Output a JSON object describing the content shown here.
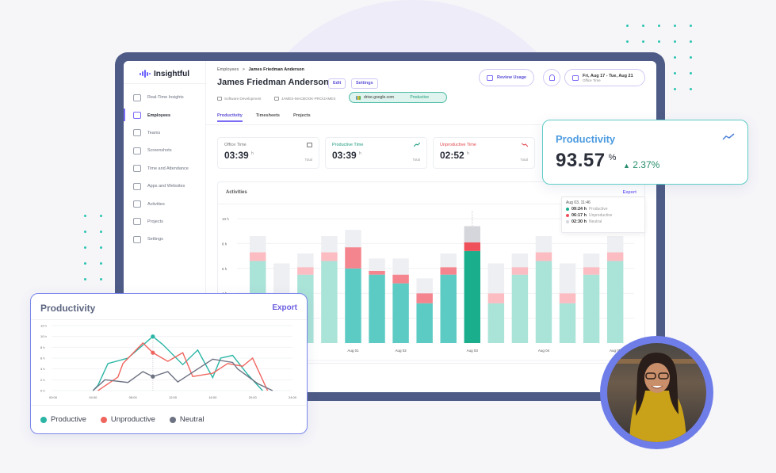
{
  "app": {
    "brand": "Insightful"
  },
  "sidebar": {
    "items": [
      {
        "label": "Real-Time Insights",
        "icon": "clock-icon",
        "active": false
      },
      {
        "label": "Employees",
        "icon": "users-icon",
        "active": true
      },
      {
        "label": "Teams",
        "icon": "teams-icon",
        "active": false
      },
      {
        "label": "Screenshots",
        "icon": "image-icon",
        "active": false
      },
      {
        "label": "Time and Attendance",
        "icon": "calendar-icon",
        "active": false
      },
      {
        "label": "Apps and Websites",
        "icon": "monitor-icon",
        "active": false
      },
      {
        "label": "Activities",
        "icon": "list-icon",
        "active": false
      },
      {
        "label": "Projects",
        "icon": "briefcase-icon",
        "active": false
      },
      {
        "label": "Settings",
        "icon": "gear-icon",
        "active": false
      }
    ]
  },
  "header": {
    "breadcrumb": {
      "parent": "Employees",
      "separator": ">",
      "current": "James Friedman Anderson"
    },
    "employee_name": "James Friedman Anderson",
    "edit_label": "Edit",
    "settings_label": "Settings",
    "department": "Software Development",
    "computer": "JAMES-MACBOOK-PRO/JAMES",
    "active_app": {
      "domain": "drive.google.com",
      "status": "Productive"
    },
    "review_usage_label": "Review Usage",
    "date_range": "Fri, Aug 17 - Tue, Aug 21",
    "date_subtitle": "Office Time"
  },
  "tabs": [
    {
      "label": "Productivity",
      "active": true
    },
    {
      "label": "Timesheets",
      "active": false
    },
    {
      "label": "Projects",
      "active": false
    }
  ],
  "stats": [
    {
      "label": "Office Time",
      "value": "03:39",
      "unit": "h",
      "footer": "Total",
      "icon": "briefcase-icon",
      "color": "#777777"
    },
    {
      "label": "Productive Time",
      "value": "03:39",
      "unit": "h",
      "footer": "Total",
      "icon": "trend-up-icon",
      "color": "#1c9b7e"
    },
    {
      "label": "Unproductive Time",
      "value": "02:52",
      "unit": "h",
      "footer": "Total",
      "icon": "trend-down-icon",
      "color": "#e0474c"
    }
  ],
  "activities": {
    "title": "Activities",
    "export_label": "Export",
    "tooltip": {
      "title": "Aug 03, 11:46",
      "rows": [
        {
          "value": "09:24 h",
          "label": "Productive",
          "color": "#1aae8c"
        },
        {
          "value": "06:17 h",
          "label": "Unproductive",
          "color": "#f0505a"
        },
        {
          "value": "02:30 h",
          "label": "Neutral",
          "color": "#d5d6db"
        }
      ]
    },
    "legend_neutral": "Neutral"
  },
  "productivity_card": {
    "title": "Productivity",
    "value": "93.57",
    "unit": "%",
    "delta": "2.37%",
    "delta_direction": "up"
  },
  "line_card": {
    "title": "Productivity",
    "export_label": "Export"
  },
  "chart_data": [
    {
      "type": "bar",
      "title": "Activities",
      "stacked": true,
      "ylim": [
        0,
        10
      ],
      "yticks": [
        "",
        "4 h",
        "6 h",
        "8 h",
        "10 h"
      ],
      "ytick_values": [
        2,
        4,
        6,
        8,
        10
      ],
      "xlabels": [
        {
          "index": 4,
          "label": "Aug 01"
        },
        {
          "index": 6,
          "label": "Aug 02"
        },
        {
          "index": 9,
          "label": "Aug 03"
        },
        {
          "index": 12,
          "label": "Aug 04"
        },
        {
          "index": 15,
          "label": "Aug 05"
        }
      ],
      "series": [
        {
          "name": "Productive",
          "values": [
            6.6,
            3.2,
            5.5,
            6.6,
            6.0,
            5.5,
            4.8,
            3.2,
            5.5,
            7.4,
            3.2,
            5.5,
            6.6,
            3.2,
            5.5,
            6.6
          ]
        },
        {
          "name": "Unproductive",
          "values": [
            0.7,
            0.8,
            0.6,
            0.7,
            1.7,
            0.3,
            0.7,
            0.8,
            0.6,
            0.7,
            0.8,
            0.6,
            0.7,
            0.8,
            0.6,
            0.7
          ]
        },
        {
          "name": "Neutral",
          "values": [
            1.3,
            2.4,
            1.1,
            1.3,
            1.4,
            1.0,
            1.3,
            1.2,
            1.1,
            1.3,
            2.4,
            1.1,
            1.3,
            2.4,
            1.1,
            1.3
          ]
        }
      ],
      "highlight_index": 9,
      "bar_shade": [
        "light",
        "light",
        "light",
        "light",
        "dark",
        "dark",
        "dark",
        "dark",
        "dark",
        "highlight",
        "light",
        "light",
        "light",
        "light",
        "light",
        "light"
      ]
    },
    {
      "type": "line",
      "title": "Productivity",
      "ylim": [
        0,
        12
      ],
      "yticks": [
        "0 h",
        "2 h",
        "4 h",
        "6 h",
        "8 h",
        "10 h",
        "12 h"
      ],
      "xticks": [
        "00:00",
        "04:00",
        "08:00",
        "12:00",
        "16:00",
        "20:00",
        "24:00"
      ],
      "xlim": [
        0,
        24
      ],
      "marker_x": 10,
      "series": [
        {
          "name": "Productive",
          "color": "#2bb5a5",
          "points": [
            [
              4,
              0
            ],
            [
              4.5,
              1
            ],
            [
              5.5,
              5
            ],
            [
              7.5,
              6
            ],
            [
              10,
              10
            ],
            [
              11,
              8.5
            ],
            [
              13,
              4.8
            ],
            [
              14.5,
              7.5
            ],
            [
              16,
              2.4
            ],
            [
              16.8,
              6
            ],
            [
              18,
              6.5
            ],
            [
              19.5,
              3
            ],
            [
              21,
              0
            ]
          ]
        },
        {
          "name": "Unproductive",
          "color": "#f0645e",
          "points": [
            [
              4.5,
              0
            ],
            [
              6.5,
              2.5
            ],
            [
              7,
              5
            ],
            [
              9,
              8.8
            ],
            [
              10,
              7
            ],
            [
              11.5,
              5.4
            ],
            [
              13,
              7
            ],
            [
              14,
              2.6
            ],
            [
              16,
              3.2
            ],
            [
              17.5,
              5
            ],
            [
              19,
              4.5
            ],
            [
              20,
              6
            ],
            [
              21.5,
              0
            ]
          ]
        },
        {
          "name": "Neutral",
          "color": "#6e7383",
          "points": [
            [
              4,
              0
            ],
            [
              5.2,
              2
            ],
            [
              7.5,
              1.5
            ],
            [
              9,
              3.5
            ],
            [
              10,
              2.6
            ],
            [
              11.5,
              3.5
            ],
            [
              12.5,
              1.6
            ],
            [
              16,
              5.8
            ],
            [
              18,
              5.2
            ],
            [
              18.5,
              4
            ],
            [
              20.5,
              1.3
            ],
            [
              22,
              0
            ]
          ]
        }
      ],
      "legend": [
        "Productive",
        "Unproductive",
        "Neutral"
      ],
      "legend_position": "bottom"
    }
  ]
}
